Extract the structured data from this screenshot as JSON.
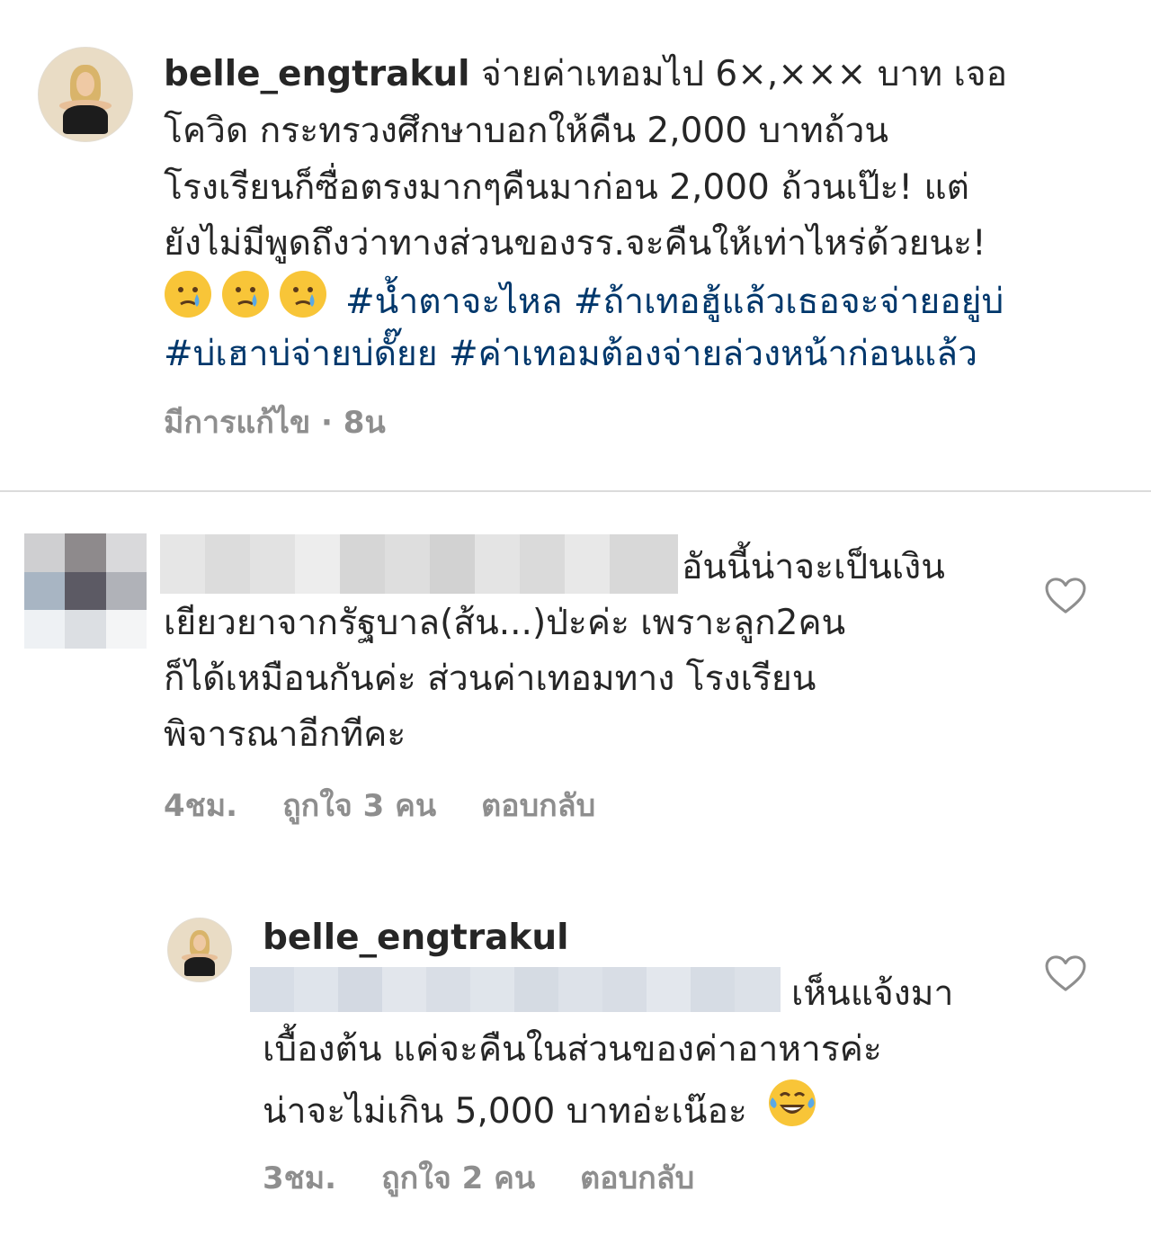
{
  "post": {
    "username": "belle_engtrakul",
    "lines": [
      " จ่ายค่าเทอมไป 6×,××× บาท เจอ",
      "โควิด กระทรวงศึกษาบอกให้คืน 2,000 บาทถ้วน",
      "โรงเรียนก็ซื่อตรงมากๆคืนมาก่อน 2,000 ถ้วนเป๊ะ! แต่",
      "ยังไม่มีพูดถึงว่าทางส่วนของรร.จะคืนให้เท่าไหร่ด้วยนะ!"
    ],
    "emojis": [
      "crying-face",
      "crying-face",
      "crying-face"
    ],
    "hashtags_line1": "#น้ำตาจะไหล #ถ้าเทอฮู้แล้วเธอจะจ่ายอยู่บ่",
    "hashtags_line2": "#บ่เฮาบ่จ่ายบ่ดั๊ยย #ค่าเทอมต้องจ่ายล่วงหน้าก่อนแล้ว",
    "meta": "มีการแก้ไข · 8น"
  },
  "comment1": {
    "lines": [
      "อันนี้น่าจะเป็นเงิน",
      "เยียวยาจากรัฐบาล(ส้น...)ป่ะค่ะ เพราะลูก2คน",
      "ก็ได้เหมือนกันค่ะ ส่วนค่าเทอมทาง โรงเรียน",
      "พิจารณาอีกทีคะ"
    ],
    "time": "4ชม.",
    "likes": "ถูกใจ 3 คน",
    "reply": "ตอบกลับ"
  },
  "reply1": {
    "username": "belle_engtrakul",
    "lines": [
      "เห็นแจ้งมา",
      "เบื้องต้น แค่จะคืนในส่วนของค่าอาหารค่ะ",
      "น่าจะไม่เกิน 5,000 บาทอ่ะเน๊อะ"
    ],
    "emoji": "laughing-tears-face",
    "time": "3ชม.",
    "likes": "ถูกใจ 2 คน",
    "reply": "ตอบกลับ"
  },
  "colors": {
    "text": "#262626",
    "hashtag": "#00376b",
    "meta": "#8e8e8e",
    "divider": "#dbdbdb"
  }
}
